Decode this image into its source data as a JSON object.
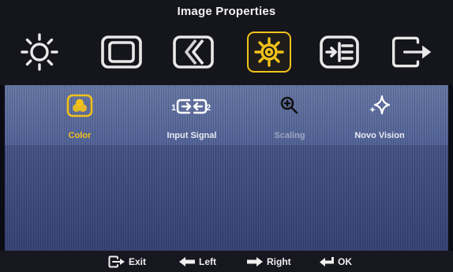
{
  "header": {
    "title": "Image Properties"
  },
  "top_menu": [
    {
      "icon": "brightness-icon",
      "selected": false
    },
    {
      "icon": "screen-frame-icon",
      "selected": false
    },
    {
      "icon": "picture-adjust-icon",
      "selected": false
    },
    {
      "icon": "gear-icon",
      "selected": true
    },
    {
      "icon": "options-list-icon",
      "selected": false
    },
    {
      "icon": "exit-icon",
      "selected": false
    }
  ],
  "submenu": {
    "items": [
      {
        "label": "Color",
        "icon": "color-circles-icon",
        "state": "selected"
      },
      {
        "label": "Input Signal",
        "icon": "input-signal-icon",
        "state": "normal"
      },
      {
        "label": "Scaling",
        "icon": "zoom-in-icon",
        "state": "dim"
      },
      {
        "label": "Novo Vision",
        "icon": "sparkle-icon",
        "state": "normal"
      }
    ],
    "input_signal_numbers": [
      "1",
      "2"
    ]
  },
  "footer": {
    "exit_label": "Exit",
    "left_label": "Left",
    "right_label": "Right",
    "ok_label": "OK"
  },
  "colors": {
    "accent": "#f2c21a",
    "submenu_bg": "#5a6a9a",
    "content_bg": "#3e4a80",
    "header_bg": "#15151c"
  }
}
